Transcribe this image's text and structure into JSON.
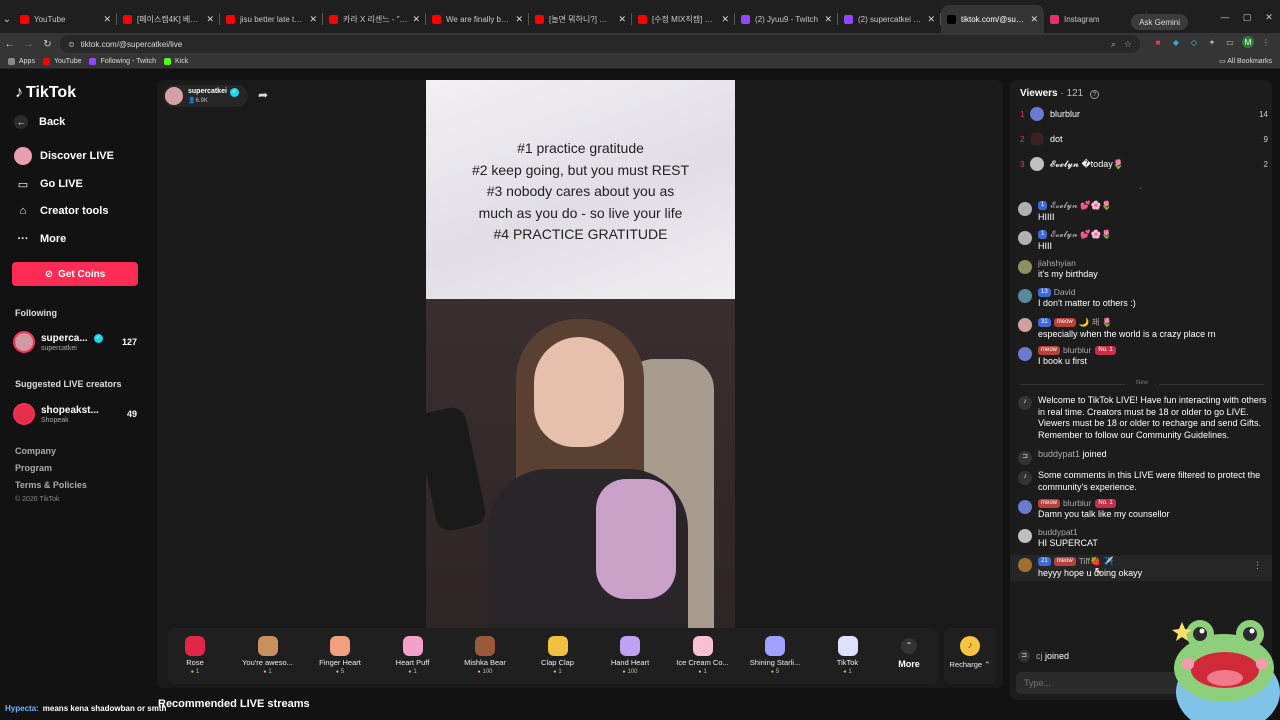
{
  "browser": {
    "tabs": [
      {
        "title": "YouTube",
        "color": "#ff0000",
        "active": false
      },
      {
        "title": "[페이스캠4K] 베이비몬",
        "color": "#ff0000",
        "active": false
      },
      {
        "title": "jisu better late than sin",
        "color": "#ff0000",
        "active": false
      },
      {
        "title": "카라 X 리센느 - \"Pretty",
        "color": "#ff0000",
        "active": false
      },
      {
        "title": "We are finally back in k",
        "color": "#ff0000",
        "active": false
      },
      {
        "title": "[놀면 뭐하니?] 옛썬쳐 ",
        "color": "#ff0000",
        "active": false
      },
      {
        "title": "[수정 MIX직캠] RESCEN",
        "color": "#ff0000",
        "active": false
      },
      {
        "title": "(2) Jyuu9 - Twitch",
        "color": "#9146ff",
        "active": false
      },
      {
        "title": "(2) supercatkei - Twitch",
        "color": "#9146ff",
        "active": false
      },
      {
        "title": "tiktok.com/@super",
        "color": "#000000",
        "active": true
      },
      {
        "title": "Instagram",
        "color": "#e1306c",
        "active": false
      }
    ],
    "ask_gemini": "Ask Gemini",
    "url": "tiktok.com/@supercatkei/live",
    "bookmarks": [
      {
        "label": "Apps",
        "color": "#888888"
      },
      {
        "label": "YouTube",
        "color": "#ff0000"
      },
      {
        "label": "Following - Twitch",
        "color": "#9146ff"
      },
      {
        "label": "Kick",
        "color": "#53fc18"
      }
    ],
    "all_bookmarks": "All Bookmarks"
  },
  "sidebar": {
    "brand": "TikTok",
    "back": "Back",
    "discover": "Discover LIVE",
    "go_live": "Go LIVE",
    "creator_tools": "Creator tools",
    "more": "More",
    "get_coins": "Get Coins",
    "following_title": "Following",
    "following": {
      "name": "superca...",
      "handle": "supercatkei",
      "count": "127"
    },
    "suggested_title": "Suggested LIVE creators",
    "suggested": {
      "name": "shopeakst...",
      "handle": "Shopeak",
      "count": "49"
    },
    "footer": [
      "Company",
      "Program",
      "Terms & Policies"
    ],
    "copyright": "© 2026 TikTok"
  },
  "stream": {
    "host_name": "supercatkei",
    "host_viewers": "6.9K",
    "overlay_lines": [
      "#1 practice gratitude",
      "#2 keep going, but you must REST",
      "#3 nobody cares about you as",
      "much as you do - so live your life",
      "#4 PRACTICE GRATITUDE"
    ]
  },
  "gifts": [
    {
      "name": "Rose",
      "price": "1",
      "color": "#e0264a"
    },
    {
      "name": "You're aweso...",
      "price": "1",
      "color": "#c89060"
    },
    {
      "name": "Finger Heart",
      "price": "5",
      "color": "#f0a080"
    },
    {
      "name": "Heart Puff",
      "price": "1",
      "color": "#f4a0c8"
    },
    {
      "name": "Mishka Bear",
      "price": "100",
      "color": "#9a5a3a"
    },
    {
      "name": "Clap Clap",
      "price": "1",
      "color": "#f0c040"
    },
    {
      "name": "Hand Heart",
      "price": "100",
      "color": "#c0a0f0"
    },
    {
      "name": "Ice Cream Co...",
      "price": "1",
      "color": "#f8c0d0"
    },
    {
      "name": "Shining Starli...",
      "price": "5",
      "color": "#a0a0ff"
    },
    {
      "name": "TikTok",
      "price": "1",
      "color": "#e0e0ff"
    }
  ],
  "gift_more": "More",
  "recharge": "Recharge ⌃",
  "recommended": "Recommended LIVE streams",
  "overlay_comment": {
    "user": "Hypecta:",
    "text": "means kena shadowban or smth"
  },
  "chat": {
    "viewers_label": "Viewers",
    "viewers_count": "· 121",
    "top_viewers": [
      {
        "rank": "1",
        "name": "blurblur",
        "score": "14",
        "color": "#6a7ad0"
      },
      {
        "rank": "2",
        "name": "dot",
        "score": "9",
        "color": "#3a2020"
      },
      {
        "rank": "3",
        "name": "𝓔𝓿𝓮𝓵𝔂𝓷 �today🌷",
        "score": "2",
        "color": "#c0c0c0"
      }
    ],
    "messages": [
      {
        "level": "1",
        "user": "𝓔𝓿𝓮𝓵𝔂𝓷 💕🌸🌷",
        "text": "HIIII",
        "meow": false,
        "no1": false,
        "color": "#b0b0b0"
      },
      {
        "level": "1",
        "user": "𝓔𝓿𝓮𝓵𝔂𝓷 💕🌸🌷",
        "text": "HIII",
        "meow": false,
        "no1": false,
        "color": "#b0b0b0"
      },
      {
        "level": "",
        "user": "jiahshyian",
        "text": "it's my birthday",
        "meow": false,
        "no1": false,
        "color": "#8a9060"
      },
      {
        "level": "13",
        "user": "David",
        "text": "I don't matter to others :)",
        "meow": false,
        "no1": false,
        "color": "#5a8a9a"
      },
      {
        "level": "31",
        "user": "🌙 쵀 🌷",
        "text": "especially when the world is a crazy place rn",
        "meow": true,
        "no1": false,
        "color": "#d0a0a0"
      },
      {
        "level": "",
        "user": "blurblur",
        "text": "I book u first",
        "meow": true,
        "no1": true,
        "color": "#6a7ad0"
      }
    ],
    "new_label": "New",
    "system_welcome": "Welcome to TikTok LIVE! Have fun interacting with others in real time. Creators must be 18 or older to go LIVE. Viewers must be 18 or older to recharge and send Gifts. Remember to follow our Community Guidelines.",
    "join1": {
      "user": "buddypat1",
      "text": "joined"
    },
    "system_filter": "Some comments in this LIVE were filtered to protect the community's experience.",
    "messages2": [
      {
        "level": "",
        "user": "blurblur",
        "text": "Damn you talk like my counsellor",
        "meow": true,
        "no1": true,
        "color": "#6a7ad0"
      },
      {
        "level": "",
        "user": "buddypat1",
        "text": "HI SUPERCAT",
        "meow": false,
        "no1": false,
        "color": "#c0c0c0"
      },
      {
        "level": "21",
        "user": "Tiff🍓 ✈️",
        "text": "heyyy hope u doing okayy",
        "meow": true,
        "no1": false,
        "color": "#a07030"
      }
    ],
    "meow_label": "meow",
    "no1_label": "No. 1",
    "join2": {
      "user": "cj",
      "text": "joined"
    },
    "type_placeholder": "Type..."
  }
}
